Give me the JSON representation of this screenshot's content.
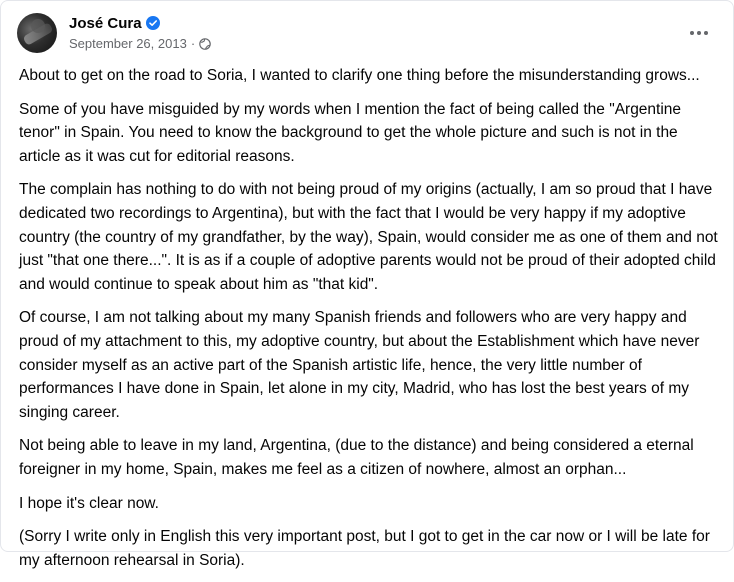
{
  "post": {
    "author": "José Cura",
    "date": "September 26, 2013",
    "separator": "·",
    "icons": {
      "verified": "verified-badge-icon",
      "audience": "globe-icon",
      "more": "more-options-icon"
    },
    "accent_color": "#1877f2",
    "paragraphs": [
      "About to get on the road to Soria, I wanted to clarify one thing before the misunderstanding grows...",
      "Some of you have misguided by my words when I mention the fact of being called the \"Argentine tenor\" in Spain. You need to know the background to get the whole picture and such is not in the article as it was cut for editorial reasons.",
      "The complain has nothing to do with not being proud of my origins (actually, I am so proud that I have dedicated two recordings to Argentina), but with the fact that I would be very happy if my adoptive country (the country of my grandfather, by the way), Spain, would consider me as one of them and not just \"that one there...\". It is as if a couple of adoptive parents would not be proud of their adopted child and would continue to speak about him as \"that kid\".",
      "Of course, I am not talking about my many Spanish friends and followers who are very happy and proud of my attachment to this, my adoptive country, but about the Establishment which have never consider myself as an active part of the Spanish artistic life, hence, the very little number of performances I have done in Spain, let alone in my city, Madrid, who has lost the best years of my singing career.",
      "Not being able to leave in my land, Argentina, (due to the distance) and being considered a eternal foreigner in my home, Spain, makes me feel as a citizen of nowhere, almost an orphan...",
      "I hope it's clear now.",
      "(Sorry I write only in English this very important post, but I got to get in the car now or I will be late for my afternoon rehearsal in Soria)."
    ]
  }
}
